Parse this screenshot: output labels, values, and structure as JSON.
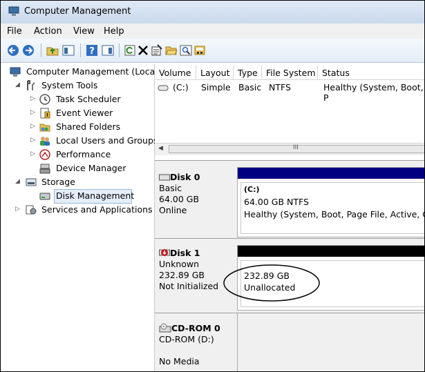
{
  "window": {
    "title": "Computer Management"
  },
  "menu": [
    "File",
    "Action",
    "View",
    "Help"
  ],
  "toolbar": {
    "icons": [
      "back-icon",
      "forward-icon",
      "up-folder-icon",
      "show-hide-tree-icon",
      "help-icon",
      "properties-pane-icon",
      "refresh-icon",
      "delete-icon",
      "properties-icon",
      "open-folder-icon",
      "search-icon",
      "disk-settings-icon"
    ]
  },
  "tree": {
    "root": "Computer Management (Local",
    "system_tools": "System Tools",
    "task_scheduler": "Task Scheduler",
    "event_viewer": "Event Viewer",
    "shared_folders": "Shared Folders",
    "local_users": "Local Users and Groups",
    "performance": "Performance",
    "device_manager": "Device Manager",
    "storage": "Storage",
    "disk_management": "Disk Management",
    "services": "Services and Applications"
  },
  "volume_list": {
    "columns": [
      "Volume",
      "Layout",
      "Type",
      "File System",
      "Status"
    ],
    "rows": [
      {
        "volume": "(C:)",
        "layout": "Simple",
        "type": "Basic",
        "fs": "NTFS",
        "status": "Healthy (System, Boot, P"
      }
    ],
    "scroll_grip": "III"
  },
  "disks": {
    "disk0": {
      "name": "Disk 0",
      "type": "Basic",
      "size": "64.00 GB",
      "state": "Online",
      "part_label": "(C:)",
      "part_size": "64.00 GB NTFS",
      "part_status": "Healthy (System, Boot, Page File, Active, Cras",
      "stripe_color": "#000080"
    },
    "disk1": {
      "name": "Disk 1",
      "type": "Unknown",
      "size": "232.89 GB",
      "state": "Not Initialized",
      "part_size": "232.89 GB",
      "part_status": "Unallocated",
      "stripe_color": "#000000"
    },
    "cdrom0": {
      "name": "CD-ROM 0",
      "drive": "CD-ROM (D:)",
      "state": "No Media"
    }
  }
}
